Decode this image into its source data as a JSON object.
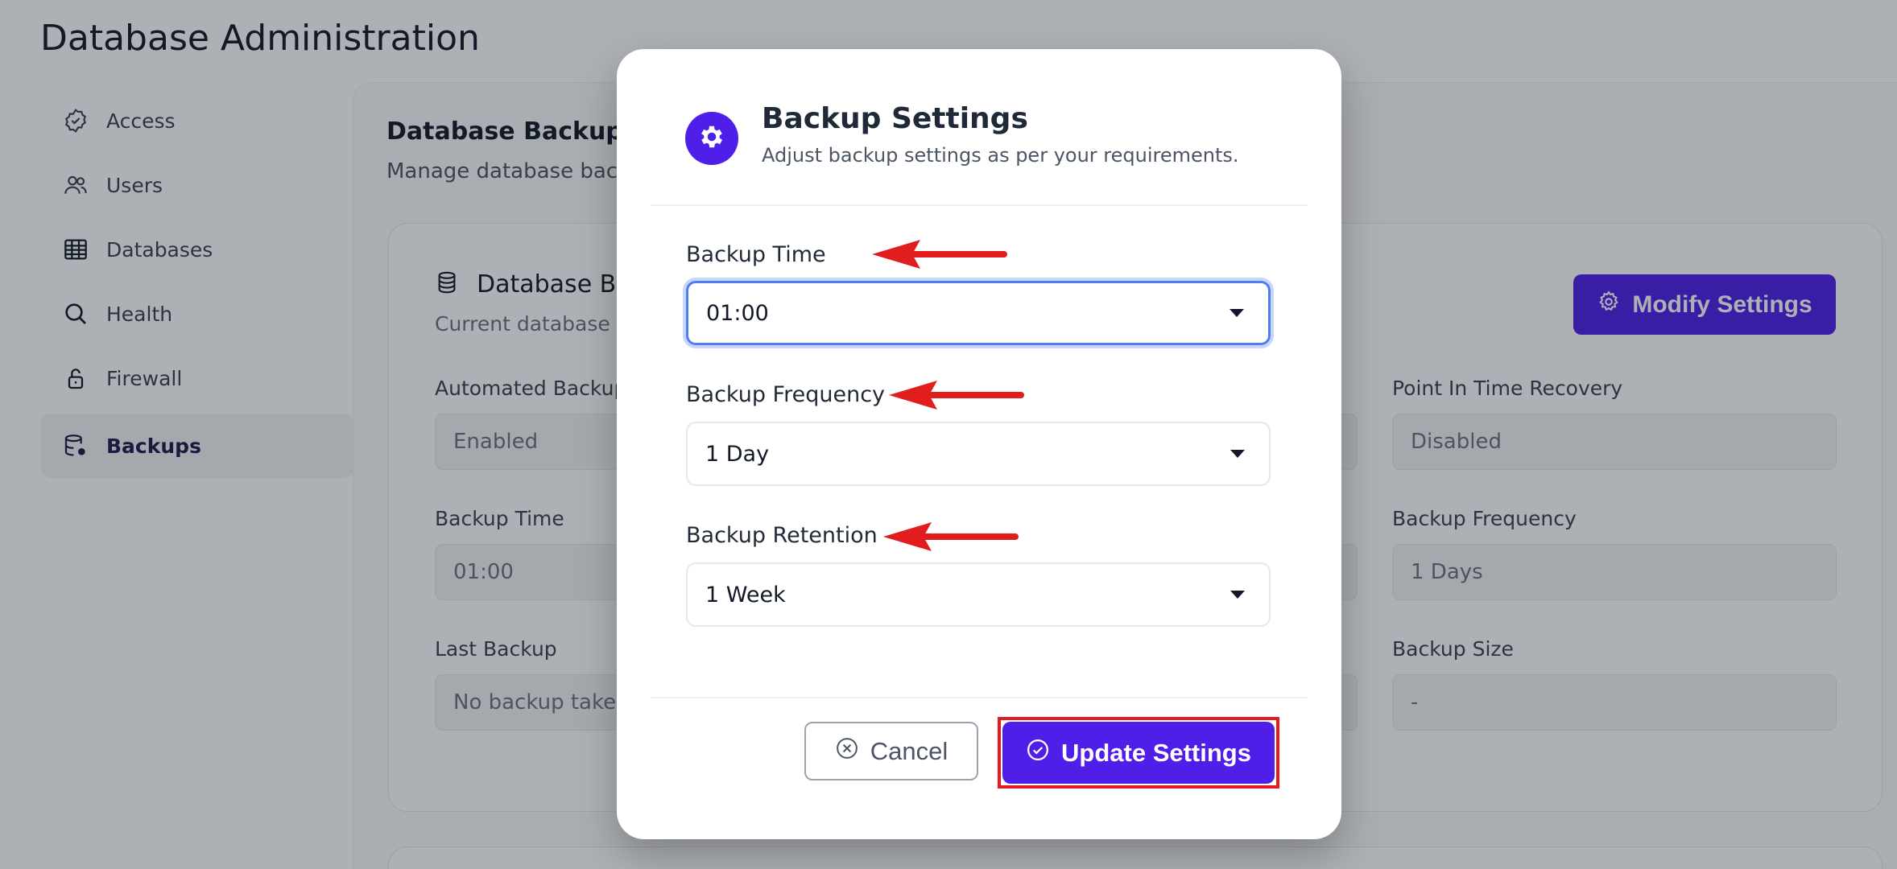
{
  "page": {
    "title": "Database Administration"
  },
  "sidebar": {
    "items": [
      {
        "label": "Access",
        "icon": "badge-check-icon"
      },
      {
        "label": "Users",
        "icon": "users-icon"
      },
      {
        "label": "Databases",
        "icon": "table-icon"
      },
      {
        "label": "Health",
        "icon": "search-icon"
      },
      {
        "label": "Firewall",
        "icon": "lock-icon"
      },
      {
        "label": "Backups",
        "icon": "database-settings-icon",
        "active": true
      }
    ]
  },
  "main": {
    "title": "Database Backup M",
    "subtitle": "Manage database bac",
    "card": {
      "title": "Database Ba",
      "subtitle": "Current database b",
      "modify_button": "Modify Settings",
      "fields": {
        "automated_backup": {
          "label": "Automated Backup",
          "value": "Enabled"
        },
        "point_in_time_recovery": {
          "label": "Point In Time Recovery",
          "value": "Disabled"
        },
        "backup_time": {
          "label": "Backup Time",
          "value": "01:00"
        },
        "backup_frequency": {
          "label": "Backup Frequency",
          "value": "1 Days"
        },
        "last_backup": {
          "label": "Last Backup",
          "value": "No backup taken"
        },
        "backup_size": {
          "label": "Backup Size",
          "value": "-"
        }
      }
    }
  },
  "modal": {
    "title": "Backup Settings",
    "subtitle": "Adjust backup settings as per your requirements.",
    "fields": {
      "backup_time": {
        "label": "Backup Time",
        "value": "01:00"
      },
      "backup_frequency": {
        "label": "Backup Frequency",
        "value": "1 Day"
      },
      "backup_retention": {
        "label": "Backup Retention",
        "value": "1 Week"
      }
    },
    "cancel_label": "Cancel",
    "update_label": "Update Settings"
  },
  "colors": {
    "accent": "#4f1ee8",
    "annotation_red": "#e11d1d",
    "focus_blue": "#4f7cf0"
  }
}
